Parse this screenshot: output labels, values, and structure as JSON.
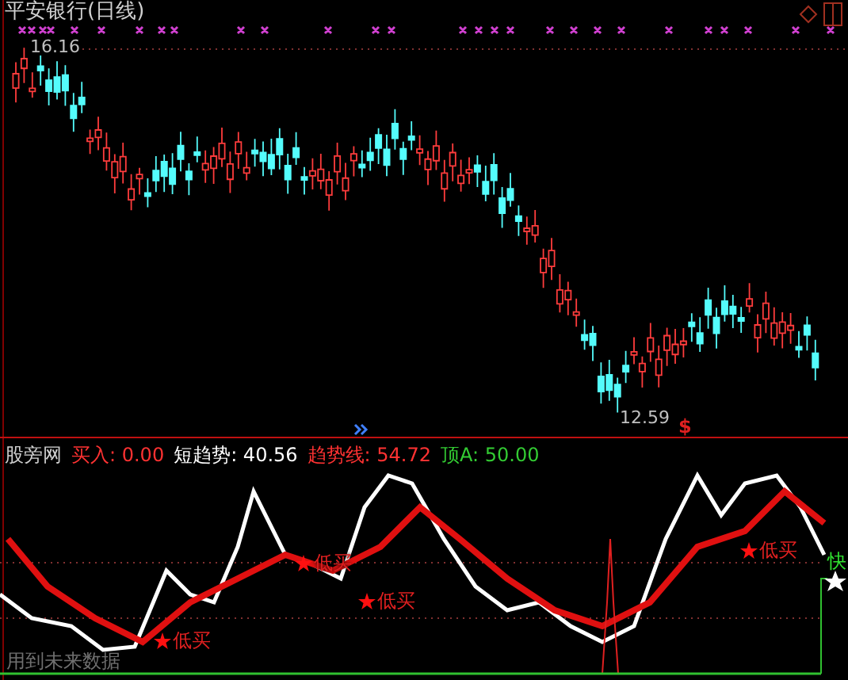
{
  "title": "平安银行(日线)",
  "price_chart": {
    "high_label": "16.16",
    "low_label": "12.59",
    "signal_mark": "$"
  },
  "indicator": {
    "name": "股旁网",
    "readouts": [
      {
        "text": "买入: 0.00",
        "color": "#ff3232"
      },
      {
        "text": "短趋势: 40.56",
        "color": "#ffffff"
      },
      {
        "text": "趋势线: 54.72",
        "color": "#ff3232"
      },
      {
        "text": "顶A: 50.00",
        "color": "#33cc33"
      }
    ],
    "markers": [
      {
        "text": "低买"
      },
      {
        "text": "低买"
      },
      {
        "text": "低买"
      },
      {
        "text": "低买"
      }
    ],
    "note": "用到未来数据",
    "edge_text": "快"
  }
}
